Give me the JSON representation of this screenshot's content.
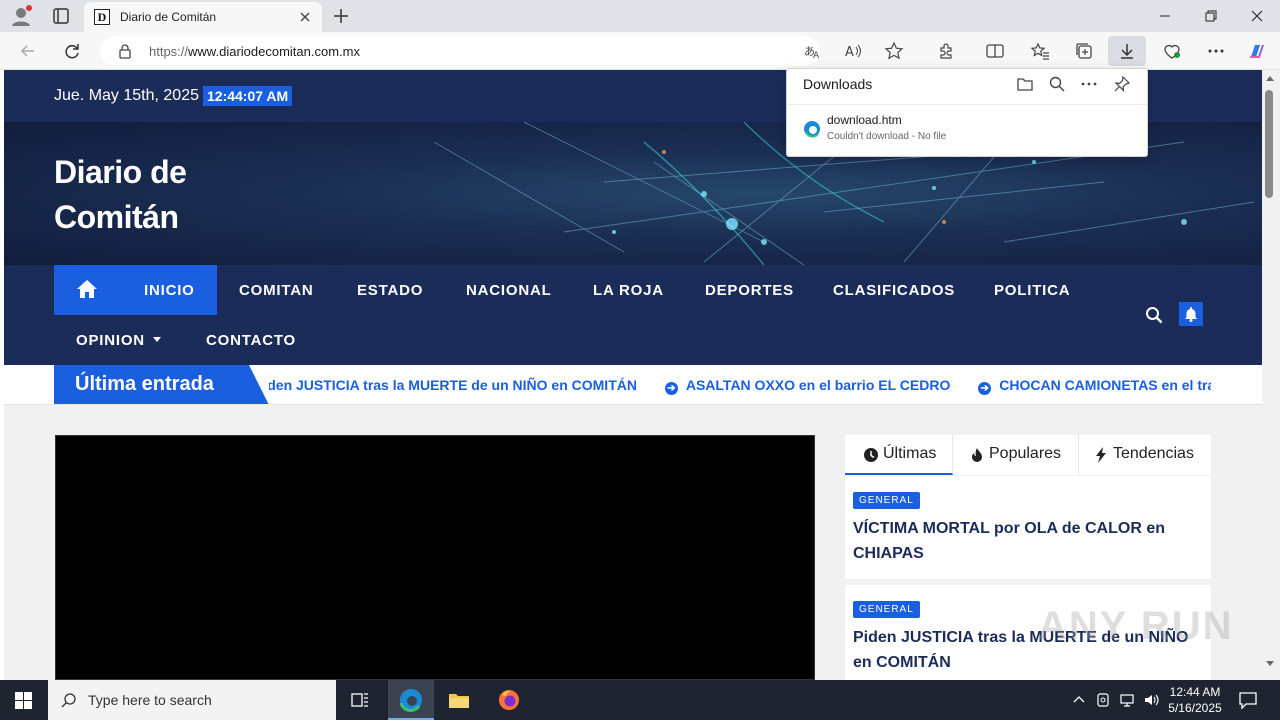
{
  "browser": {
    "tab_title": "Diario de Comitán",
    "tab_favicon_letter": "D",
    "url_prefix": "https://",
    "url_host": "www.diariodecomitan.com.mx",
    "window_controls": [
      "minimize-icon",
      "restore-icon",
      "close-icon"
    ]
  },
  "downloads": {
    "title": "Downloads",
    "file_name": "download.htm",
    "status": "Couldn't download - No file"
  },
  "site": {
    "date": "Jue. May 15th, 2025",
    "clock": "12:44:07 AM",
    "name_line1": "Diario de",
    "name_line2": "Comitán",
    "nav": [
      "INICIO",
      "COMITAN",
      "ESTADO",
      "NACIONAL",
      "LA ROJA",
      "DEPORTES",
      "CLASIFICADOS",
      "POLITICA",
      "OPINION",
      "CONTACTO"
    ],
    "ticker_label": "Última entrada",
    "ticker_items": [
      "Piden JUSTICIA tras la MUERTE de un NIÑO en COMITÁN",
      "ASALTAN OXXO en el barrio EL CEDRO",
      "CHOCAN CAMIONETAS en el tramo COMITÁN–TZIMOL"
    ],
    "tabs": [
      "Últimas",
      "Populares",
      "Tendencias"
    ],
    "posts": [
      {
        "category": "GENERAL",
        "title": "VÍCTIMA MORTAL por OLA de CALOR en CHIAPAS"
      },
      {
        "category": "GENERAL",
        "title": "Piden JUSTICIA tras la MUERTE de un NIÑO en COMITÁN"
      }
    ]
  },
  "taskbar": {
    "search_placeholder": "Type here to search",
    "time": "12:44 AM",
    "date": "5/16/2025"
  },
  "watermark": "ANY RUN",
  "colors": {
    "navy": "#1c2c59",
    "accent_blue": "#1a5fe0",
    "taskbar": "#1f2530"
  }
}
